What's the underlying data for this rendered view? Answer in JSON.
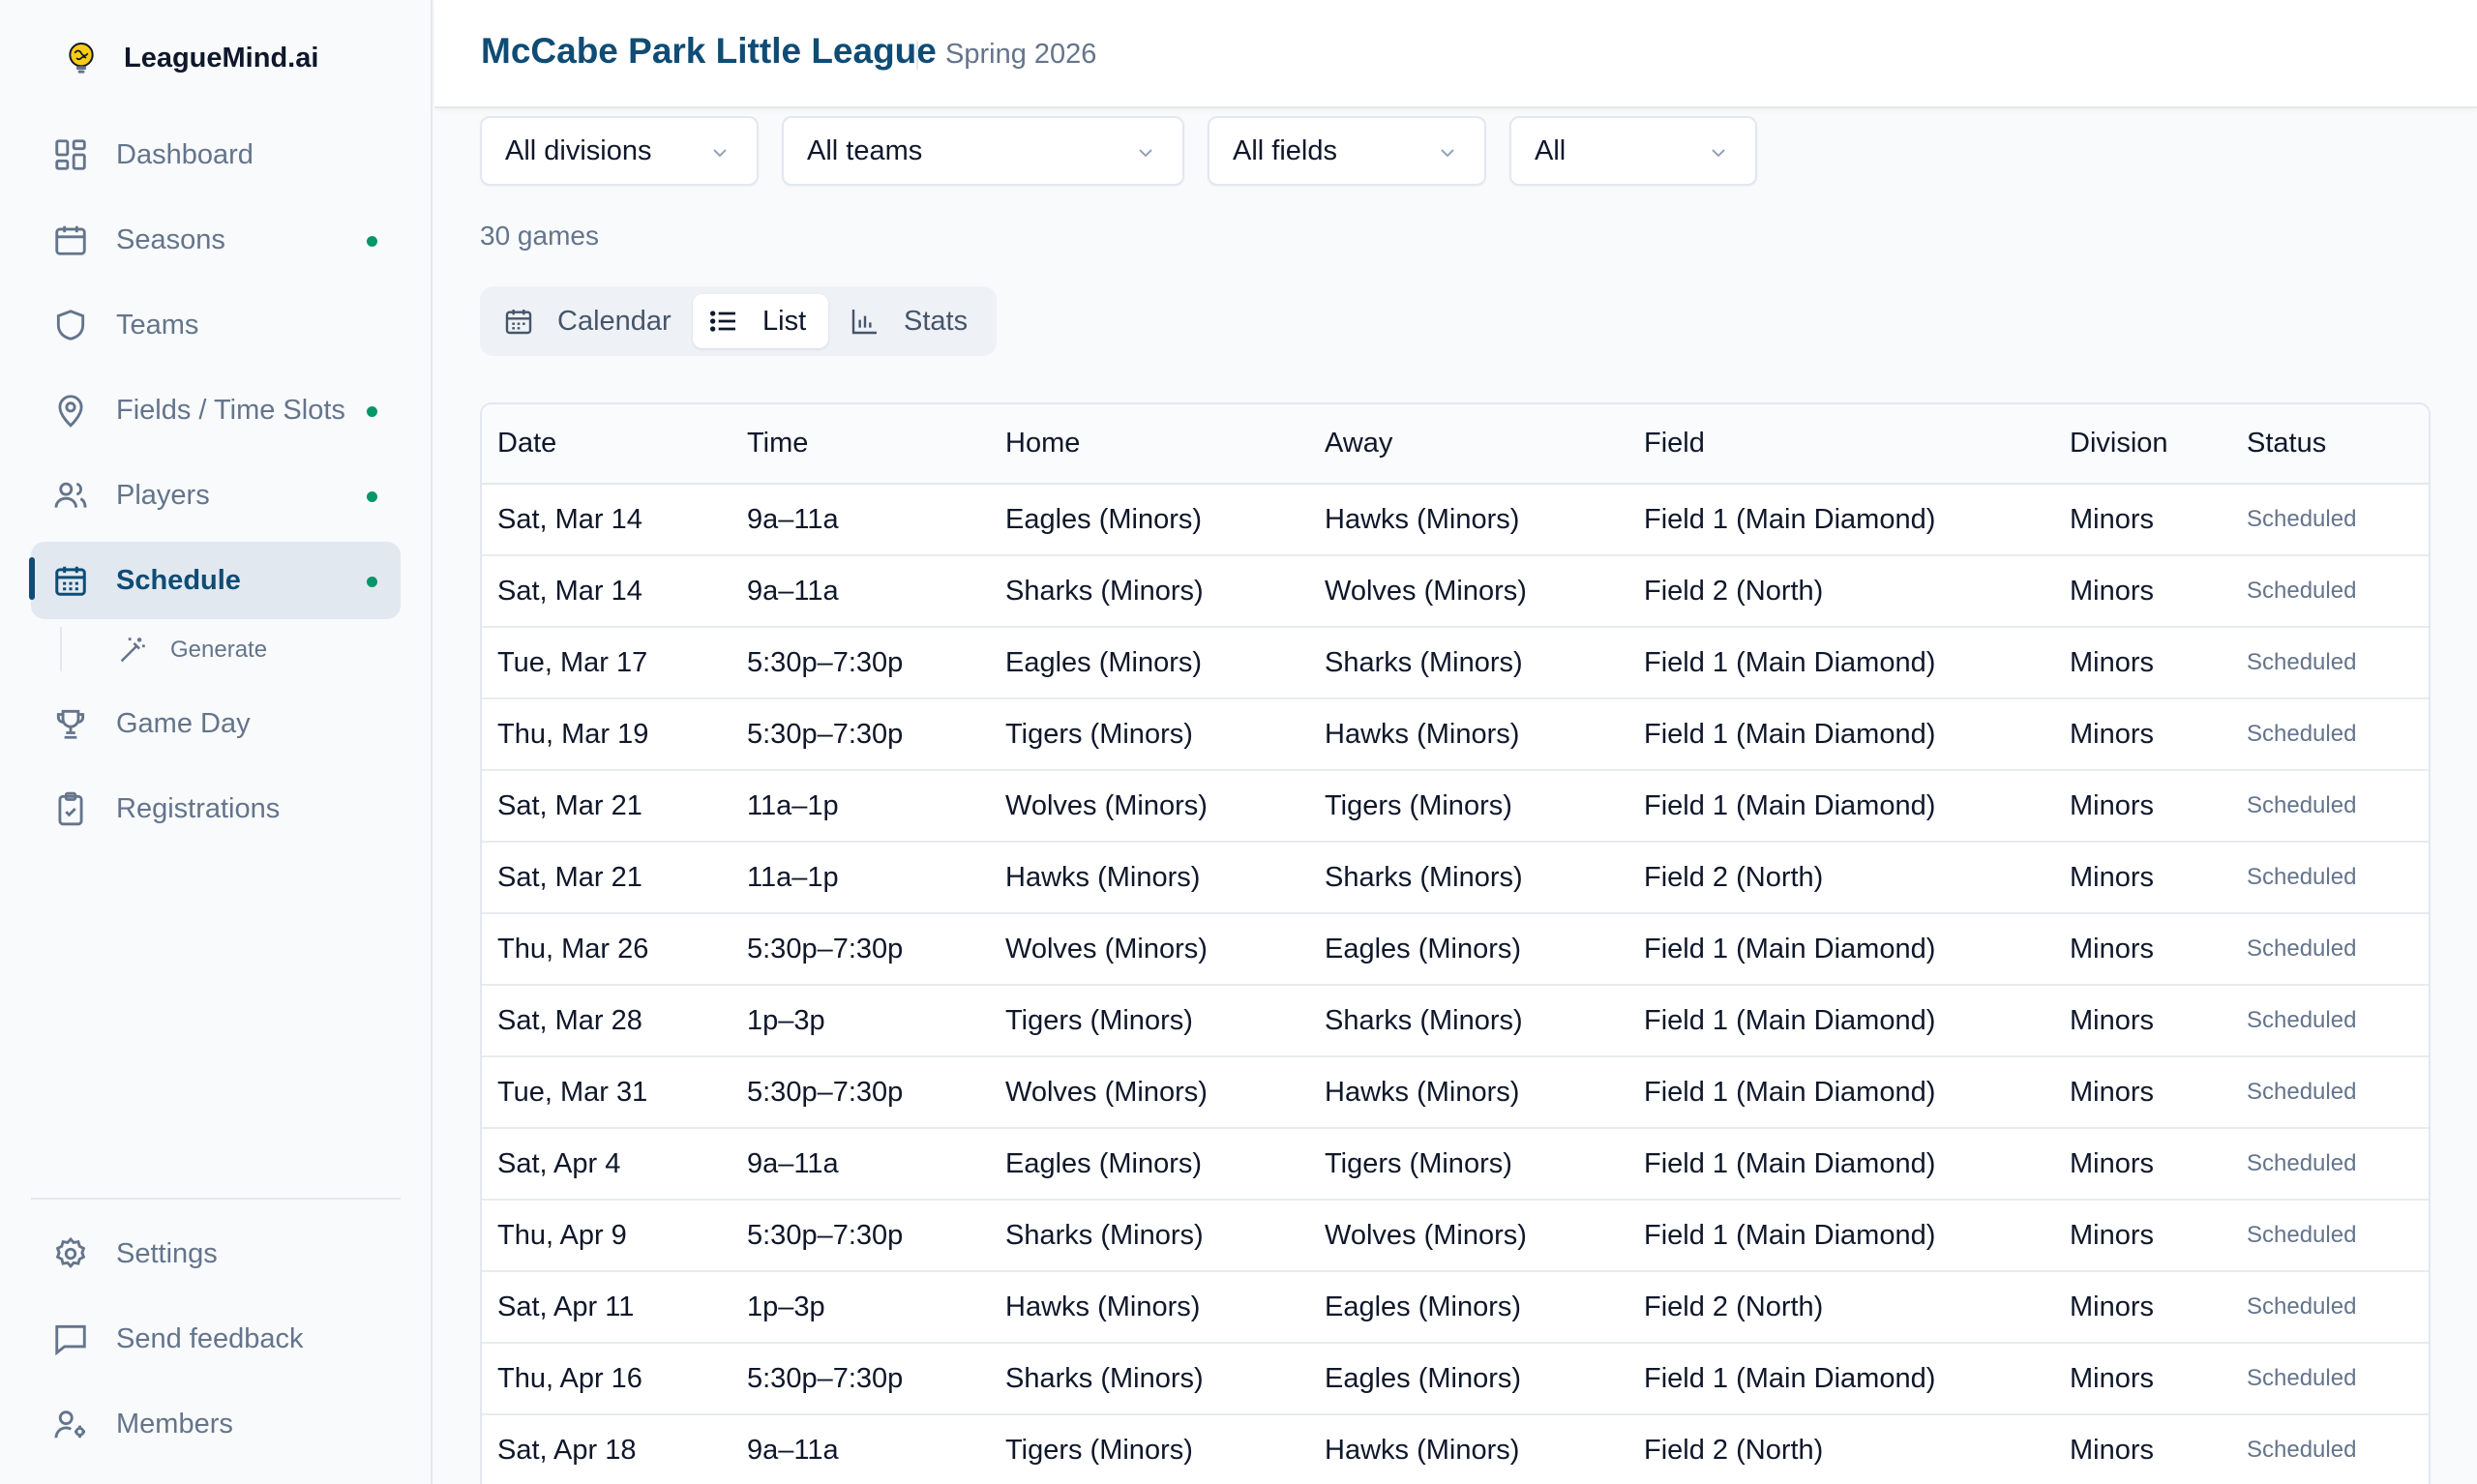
{
  "app": {
    "name": "LeagueMind.ai",
    "logo_icon": "lightbulb-brain-icon"
  },
  "sidebar": {
    "items": [
      {
        "label": "Dashboard",
        "icon": "dashboard-grid-icon",
        "dot": false
      },
      {
        "label": "Seasons",
        "icon": "calendar-icon",
        "dot": true
      },
      {
        "label": "Teams",
        "icon": "shield-icon",
        "dot": false
      },
      {
        "label": "Fields / Time Slots",
        "icon": "map-pin-icon",
        "dot": true
      },
      {
        "label": "Players",
        "icon": "users-icon",
        "dot": true
      },
      {
        "label": "Schedule",
        "icon": "calendar-grid-icon",
        "dot": true,
        "active": true
      },
      {
        "label": "Game Day",
        "icon": "trophy-icon",
        "dot": false
      },
      {
        "label": "Registrations",
        "icon": "clipboard-check-icon",
        "dot": false
      }
    ],
    "subitem": {
      "label": "Generate",
      "icon": "magic-wand-icon"
    },
    "bottom": [
      {
        "label": "Settings",
        "icon": "gear-icon"
      },
      {
        "label": "Send feedback",
        "icon": "message-square-icon"
      },
      {
        "label": "Members",
        "icon": "user-cog-icon"
      }
    ],
    "dot_color": "#059669"
  },
  "header": {
    "title": "McCabe Park Little League",
    "season": "Spring 2026"
  },
  "filters": {
    "division": "All divisions",
    "team": "All teams",
    "field": "All fields",
    "status": "All"
  },
  "games_count": "30 games",
  "views": {
    "calendar": "Calendar",
    "list": "List",
    "stats": "Stats",
    "active": "List"
  },
  "table": {
    "headers": [
      "Date",
      "Time",
      "Home",
      "Away",
      "Field",
      "Division",
      "Status"
    ],
    "rows": [
      [
        "Sat, Mar 14",
        "9a–11a",
        "Eagles (Minors)",
        "Hawks (Minors)",
        "Field 1 (Main Diamond)",
        "Minors",
        "Scheduled"
      ],
      [
        "Sat, Mar 14",
        "9a–11a",
        "Sharks (Minors)",
        "Wolves (Minors)",
        "Field 2 (North)",
        "Minors",
        "Scheduled"
      ],
      [
        "Tue, Mar 17",
        "5:30p–7:30p",
        "Eagles (Minors)",
        "Sharks (Minors)",
        "Field 1 (Main Diamond)",
        "Minors",
        "Scheduled"
      ],
      [
        "Thu, Mar 19",
        "5:30p–7:30p",
        "Tigers (Minors)",
        "Hawks (Minors)",
        "Field 1 (Main Diamond)",
        "Minors",
        "Scheduled"
      ],
      [
        "Sat, Mar 21",
        "11a–1p",
        "Wolves (Minors)",
        "Tigers (Minors)",
        "Field 1 (Main Diamond)",
        "Minors",
        "Scheduled"
      ],
      [
        "Sat, Mar 21",
        "11a–1p",
        "Hawks (Minors)",
        "Sharks (Minors)",
        "Field 2 (North)",
        "Minors",
        "Scheduled"
      ],
      [
        "Thu, Mar 26",
        "5:30p–7:30p",
        "Wolves (Minors)",
        "Eagles (Minors)",
        "Field 1 (Main Diamond)",
        "Minors",
        "Scheduled"
      ],
      [
        "Sat, Mar 28",
        "1p–3p",
        "Tigers (Minors)",
        "Sharks (Minors)",
        "Field 1 (Main Diamond)",
        "Minors",
        "Scheduled"
      ],
      [
        "Tue, Mar 31",
        "5:30p–7:30p",
        "Wolves (Minors)",
        "Hawks (Minors)",
        "Field 1 (Main Diamond)",
        "Minors",
        "Scheduled"
      ],
      [
        "Sat, Apr 4",
        "9a–11a",
        "Eagles (Minors)",
        "Tigers (Minors)",
        "Field 1 (Main Diamond)",
        "Minors",
        "Scheduled"
      ],
      [
        "Thu, Apr 9",
        "5:30p–7:30p",
        "Sharks (Minors)",
        "Wolves (Minors)",
        "Field 1 (Main Diamond)",
        "Minors",
        "Scheduled"
      ],
      [
        "Sat, Apr 11",
        "1p–3p",
        "Hawks (Minors)",
        "Eagles (Minors)",
        "Field 2 (North)",
        "Minors",
        "Scheduled"
      ],
      [
        "Thu, Apr 16",
        "5:30p–7:30p",
        "Sharks (Minors)",
        "Eagles (Minors)",
        "Field 1 (Main Diamond)",
        "Minors",
        "Scheduled"
      ],
      [
        "Sat, Apr 18",
        "9a–11a",
        "Tigers (Minors)",
        "Hawks (Minors)",
        "Field 2 (North)",
        "Minors",
        "Scheduled"
      ]
    ]
  },
  "colors": {
    "accent": "#0f4c75",
    "muted": "#64748b",
    "border": "#e2e8f0"
  }
}
